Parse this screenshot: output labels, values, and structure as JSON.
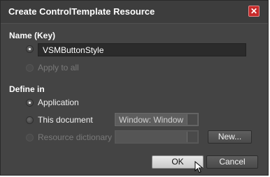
{
  "dialog": {
    "title": "Create ControlTemplate Resource",
    "close_symbol": "✕"
  },
  "name_section": {
    "heading": "Name (Key)",
    "name_value": "VSMButtonStyle",
    "apply_to_all_label": "Apply to all"
  },
  "define_section": {
    "heading": "Define in",
    "application_label": "Application",
    "this_document_label": "This document",
    "document_combo_value": "Window: Window",
    "resource_dictionary_label": "Resource dictionary",
    "new_button_label": "New..."
  },
  "footer": {
    "ok_label": "OK",
    "cancel_label": "Cancel"
  },
  "icons": {
    "close": "close-icon",
    "cursor": "mouse-pointer-icon"
  },
  "colors": {
    "background": "#444444",
    "close_button": "#c72a2a",
    "textbox": "#2b2b2b"
  }
}
